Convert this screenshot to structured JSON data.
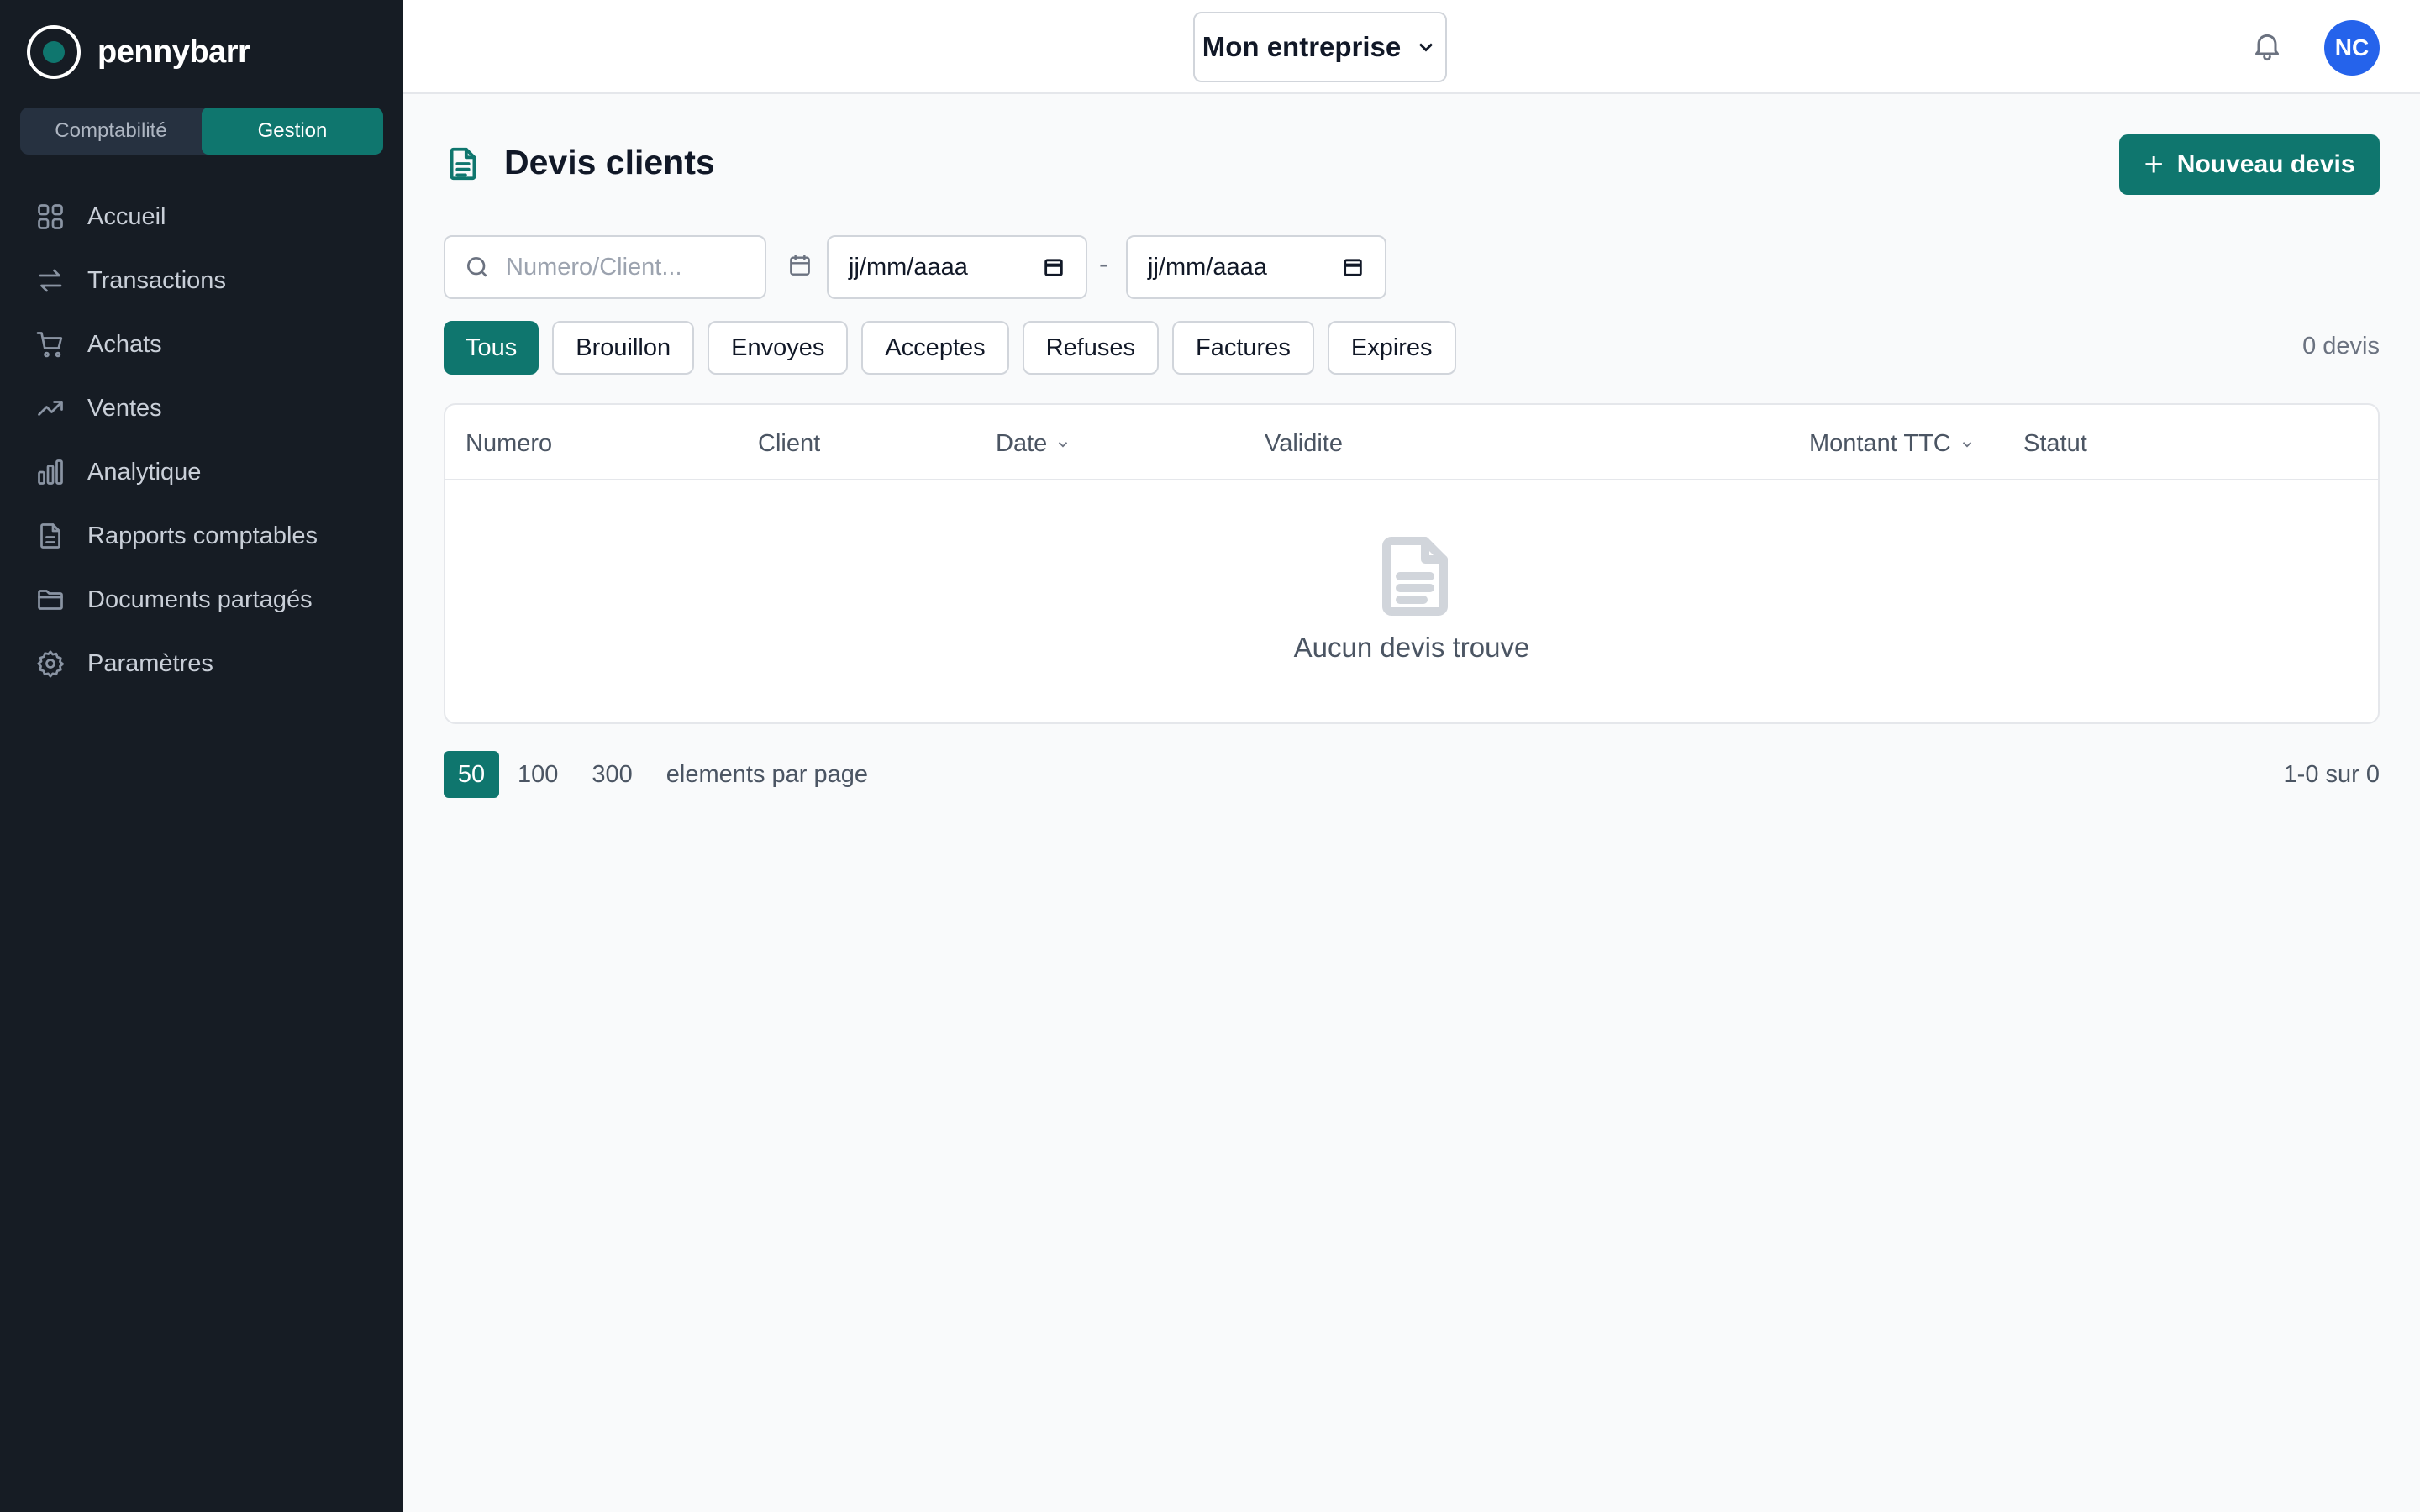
{
  "brand": {
    "name": "pennybarr"
  },
  "modes": [
    {
      "label": "Comptabilité",
      "active": false
    },
    {
      "label": "Gestion",
      "active": true
    }
  ],
  "sidebar": {
    "items": [
      {
        "label": "Accueil",
        "icon": "grid-icon"
      },
      {
        "label": "Transactions",
        "icon": "arrows-icon"
      },
      {
        "label": "Achats",
        "icon": "cart-icon"
      },
      {
        "label": "Ventes",
        "icon": "trending-up-icon"
      },
      {
        "label": "Analytique",
        "icon": "bar-chart-icon"
      },
      {
        "label": "Rapports comptables",
        "icon": "file-icon"
      },
      {
        "label": "Documents partagés",
        "icon": "folder-icon"
      },
      {
        "label": "Paramètres",
        "icon": "gear-icon"
      }
    ]
  },
  "header": {
    "company": "Mon entreprise",
    "avatar_initials": "NC"
  },
  "page": {
    "title": "Devis clients",
    "new_button": "Nouveau devis"
  },
  "search": {
    "placeholder": "Numero/Client..."
  },
  "dates": {
    "from": "jj/mm/aaaa",
    "separator": "-",
    "to": "jj/mm/aaaa"
  },
  "filters": [
    {
      "label": "Tous",
      "active": true
    },
    {
      "label": "Brouillon",
      "active": false
    },
    {
      "label": "Envoyes",
      "active": false
    },
    {
      "label": "Acceptes",
      "active": false
    },
    {
      "label": "Refuses",
      "active": false
    },
    {
      "label": "Factures",
      "active": false
    },
    {
      "label": "Expires",
      "active": false
    }
  ],
  "count": "0 devis",
  "table": {
    "columns": {
      "numero": "Numero",
      "client": "Client",
      "date": "Date",
      "validite": "Validite",
      "montant": "Montant TTC",
      "statut": "Statut"
    },
    "empty_message": "Aucun devis trouve"
  },
  "pagination": {
    "sizes": [
      "50",
      "100",
      "300"
    ],
    "selected": "50",
    "label": "elements par page",
    "range": "1-0 sur 0"
  },
  "colors": {
    "accent": "#0f766e",
    "sidebar": "#161c24",
    "avatar": "#2563eb"
  }
}
